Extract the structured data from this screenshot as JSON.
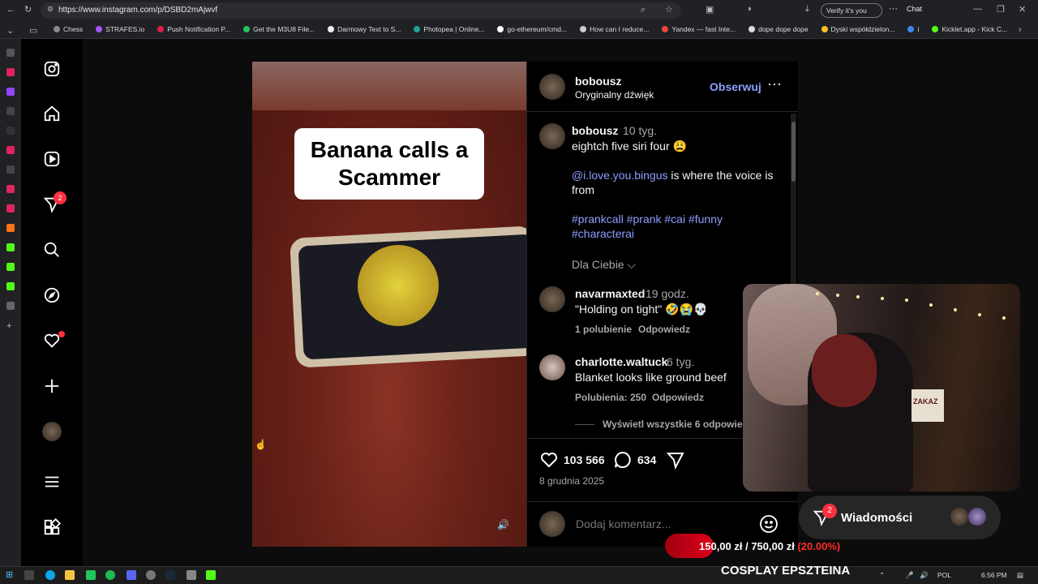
{
  "browser": {
    "url": "https://www.instagram.com/p/DSBD2mAjwvf",
    "verify_label": "Verify it's you",
    "chat_label": "Chat",
    "bookmarks": [
      {
        "label": "Chess",
        "color": "#8a8a8a"
      },
      {
        "label": "STRAFES.io",
        "color": "#a855f7"
      },
      {
        "label": "Push Notification P...",
        "color": "#e11d48"
      },
      {
        "label": "Get the M3U8 File...",
        "color": "#22c55e"
      },
      {
        "label": "Darmowy Text to S...",
        "color": "#eeeeee"
      },
      {
        "label": "Photopea | Online...",
        "color": "#18a497"
      },
      {
        "label": "go-ethereum/cmd...",
        "color": "#ffffff"
      },
      {
        "label": "How can I reduce...",
        "color": "#cccccc"
      },
      {
        "label": "Yandex — fast Inte...",
        "color": "#ef4444"
      },
      {
        "label": "dope dope dope",
        "color": "#dddddd"
      },
      {
        "label": "Dyski współdzielon...",
        "color": "#fbbf24"
      },
      {
        "label": "i",
        "color": "#4285f4"
      },
      {
        "label": "Kicklet.app - Kick C...",
        "color": "#53fc18"
      }
    ]
  },
  "sidebar": {
    "notifications_badge": "2"
  },
  "post": {
    "video_caption": "Banana calls a Scammer",
    "author": "bobousz",
    "audio": "Oryginalny dźwięk",
    "follow_label": "Obserwuj",
    "caption_author": "bobousz",
    "caption_age": "10 tyg.",
    "caption_line1": "eightch five siri four 😩",
    "mention": "@i.love.you.bingus",
    "mention_rest": " is where the voice is from",
    "hashtags": "#prankcall #prank #cai #funny #characterai",
    "dla_ciebie": "Dla Ciebie",
    "likes": "103 566",
    "comments_count": "634",
    "date": "8 grudnia 2025",
    "add_comment_placeholder": "Dodaj komentarz..."
  },
  "comments": [
    {
      "user": "navarmaxted",
      "age": "19 godz.",
      "text": "\"Holding on tight\" 🤣😭💀",
      "likes": "1 polubienie",
      "reply": "Odpowiedz"
    },
    {
      "user": "charlotte.waltuck",
      "age": "6 tyg.",
      "text": "Blanket looks like ground beef",
      "likes": "Polubienia: 250",
      "reply": "Odpowiedz",
      "view_replies": "Wyświetl wszystkie 6 odpowiedzi"
    }
  ],
  "messages": {
    "label": "Wiadomości",
    "badge": "2"
  },
  "overlay": {
    "money": "150,00 zł / 750,00 zł",
    "percent": "(20.00%)",
    "title": "COSPLAY EPSZTEINA",
    "webcam_sign": "ZAKAZ"
  },
  "taskbar": {
    "lang": "POL",
    "time": "6:56 PM"
  }
}
